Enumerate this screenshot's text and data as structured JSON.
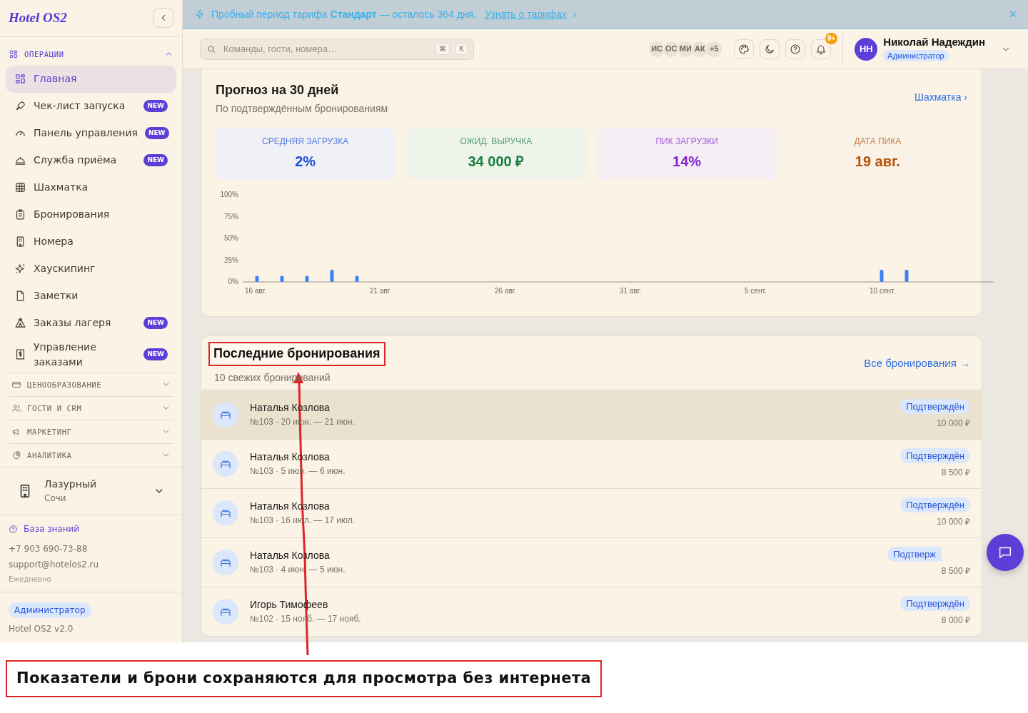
{
  "banner": {
    "text": "Пробный период тарифа **Стандарт** — осталось 364 дня.",
    "link": "Узнать о тарифах",
    "link_arrow": "›",
    "close": "×"
  },
  "sidebar": {
    "logo": "Hotel OS2",
    "sections": [
      {
        "label": "ОПЕРАЦИИ",
        "expanded": true,
        "items": [
          {
            "label": "Главная",
            "selected": true
          },
          {
            "label": "Чек-лист запуска",
            "selected": false,
            "badge": "NEW"
          },
          {
            "label": "Панель управления",
            "selected": false,
            "badge": "NEW"
          },
          {
            "label": "Служба приёма",
            "selected": false,
            "badge": "NEW"
          },
          {
            "label": "Шахматка",
            "selected": false
          },
          {
            "label": "Бронирования",
            "selected": false
          },
          {
            "label": "Номера",
            "selected": false
          },
          {
            "label": "Хаускипинг",
            "selected": false
          },
          {
            "label": "Заметки",
            "selected": false
          },
          {
            "label": "Заказы лагеря",
            "selected": false,
            "badge": "NEW"
          },
          {
            "label": "Управление заказами",
            "selected": false,
            "badge": "NEW"
          }
        ]
      },
      {
        "label": "ЦЕНООБРАЗОВАНИЕ",
        "expanded": false
      },
      {
        "label": "ГОСТИ И CRM",
        "expanded": false
      },
      {
        "label": "МАРКЕТИНГ",
        "expanded": false
      },
      {
        "label": "АНАЛИТИКА",
        "expanded": false
      }
    ],
    "property": {
      "name": "Лазурный",
      "city": "Сочи"
    },
    "support": {
      "link": "База знаний",
      "phone": "+7 903 690-73-88",
      "email": "support@hotelos2.ru",
      "hours": "Ежедневно"
    },
    "footer": {
      "role": "Администратор",
      "version": "Hotel OS2 v2.0"
    }
  },
  "topbar": {
    "search": {
      "placeholder": "Команды, гости, номера…",
      "keys": [
        "⌘",
        "K"
      ]
    },
    "team": [
      "ИС",
      "ОС",
      "МИ",
      "АК",
      "+5"
    ],
    "notifications": "9+",
    "user": {
      "initials": "НН",
      "name": "Николай Надеждин",
      "role": "Администратор"
    }
  },
  "forecast": {
    "title": "Прогноз на 30 дней",
    "subtitle": "По подтверждённым бронированиям",
    "link": "Шахматка",
    "link_arrow": "›",
    "stats": [
      {
        "label": "СРЕДНЯЯ ЗАГРУЗКА",
        "value": "2%",
        "color": "#1d4ed8"
      },
      {
        "label": "ОЖИД. ВЫРУЧКА",
        "value": "34 000 ₽",
        "color": "#15803d"
      },
      {
        "label": "ПИК ЗАГРУЗКИ",
        "value": "14%",
        "color": "#7e22ce"
      },
      {
        "label": "ДАТА ПИКА",
        "value": "19 авг.",
        "color": "#b45309"
      }
    ],
    "chart_data": {
      "type": "bar",
      "categories": [
        "16 авг.",
        null,
        null,
        null,
        null,
        "21 авг.",
        null,
        null,
        null,
        null,
        "26 авг.",
        null,
        null,
        null,
        null,
        "31 авг.",
        null,
        null,
        null,
        null,
        "5 сент.",
        null,
        null,
        null,
        null,
        "10 сент.",
        null,
        null,
        null,
        null
      ],
      "series": [
        {
          "color": "#3b82f6",
          "values": [
            7,
            7,
            7,
            14,
            7,
            0,
            0,
            0,
            0,
            0,
            0,
            0,
            0,
            0,
            0,
            0,
            0,
            0,
            0,
            0,
            0,
            0,
            0,
            0,
            0,
            14,
            14,
            0,
            0,
            0
          ]
        }
      ],
      "ylim": [
        0,
        100
      ],
      "yticks": [
        {
          "value": 0,
          "label": "0%"
        },
        {
          "value": 25,
          "label": "25%"
        },
        {
          "value": 50,
          "label": "50%"
        },
        {
          "value": 75,
          "label": "75%"
        },
        {
          "value": 100,
          "label": "100%"
        }
      ]
    }
  },
  "recent": {
    "title": "Последние бронирования",
    "subtitle": "10 свежих бронирований",
    "link": "Все бронирования →",
    "bookings": [
      {
        "guest": "Наталья Козлова",
        "details": "№103 · 20 июн. — 21 июн.",
        "status": "Подтверждён",
        "price": "10 000 ₽",
        "selected": true
      },
      {
        "guest": "Наталья Козлова",
        "details": "№103 · 5 июн. — 6 июн.",
        "status": "Подтверждён",
        "price": "8 500 ₽",
        "selected": false
      },
      {
        "guest": "Наталья Козлова",
        "details": "№103 · 16 июл. — 17 июл.",
        "status": "Подтверждён",
        "price": "10 000 ₽",
        "selected": false
      },
      {
        "guest": "Наталья Козлова",
        "details": "№103 · 4 июн. — 5 июн.",
        "status": "Подтверж",
        "price": "8 500 ₽",
        "selected": false
      },
      {
        "guest": "Игорь Тимофеев",
        "details": "№102 · 15 нояб. — 17 нояб.",
        "status": "Подтверждён",
        "price": "8 000 ₽",
        "selected": false
      }
    ]
  },
  "annotation": {
    "caption": "Показатели и брони сохраняются для просмотра без интернета"
  }
}
